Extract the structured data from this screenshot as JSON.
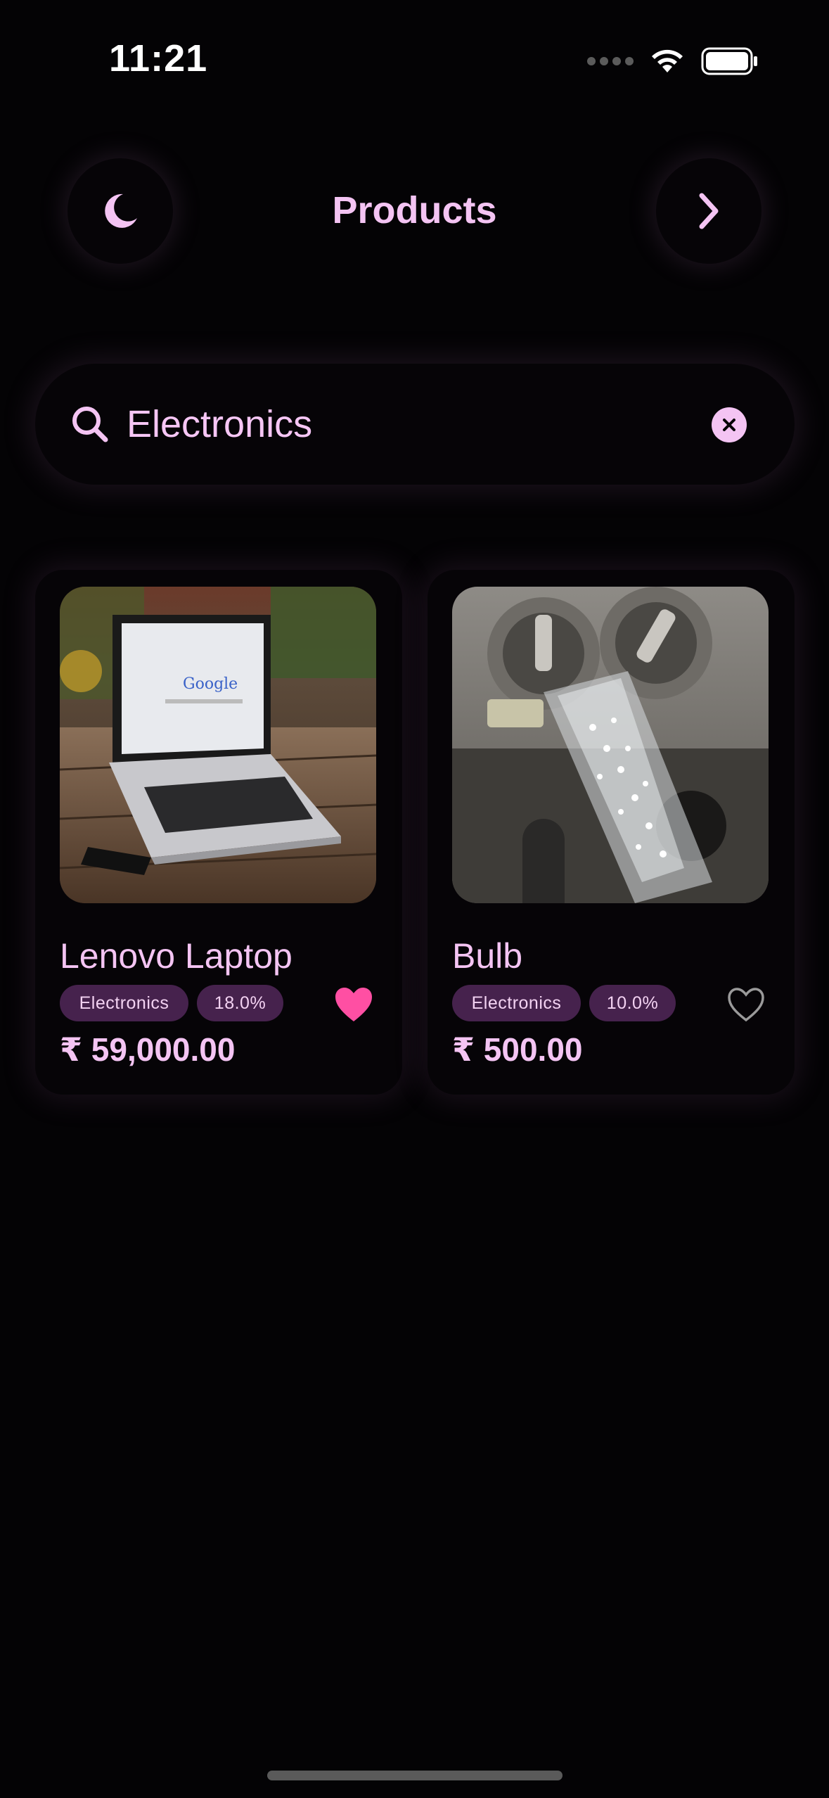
{
  "status_bar": {
    "time": "11:21"
  },
  "header": {
    "title": "Products",
    "theme_icon": "moon-icon",
    "next_icon": "chevron-right-icon"
  },
  "search": {
    "value": "Electronics",
    "placeholder": "",
    "icon": "search-icon",
    "clear_icon": "close-icon"
  },
  "products": [
    {
      "name": "Lenovo Laptop",
      "category": "Electronics",
      "discount": "18.0%",
      "price": "₹ 59,000.00",
      "favorite": true,
      "image": "laptop-photo"
    },
    {
      "name": "Bulb",
      "category": "Electronics",
      "discount": "10.0%",
      "price": "₹ 500.00",
      "favorite": false,
      "image": "bulb-photo"
    }
  ],
  "colors": {
    "accent": "#f4c4f3",
    "chip_bg": "#46224d",
    "favorite_active": "#ff4fa3",
    "background": "#040305"
  }
}
